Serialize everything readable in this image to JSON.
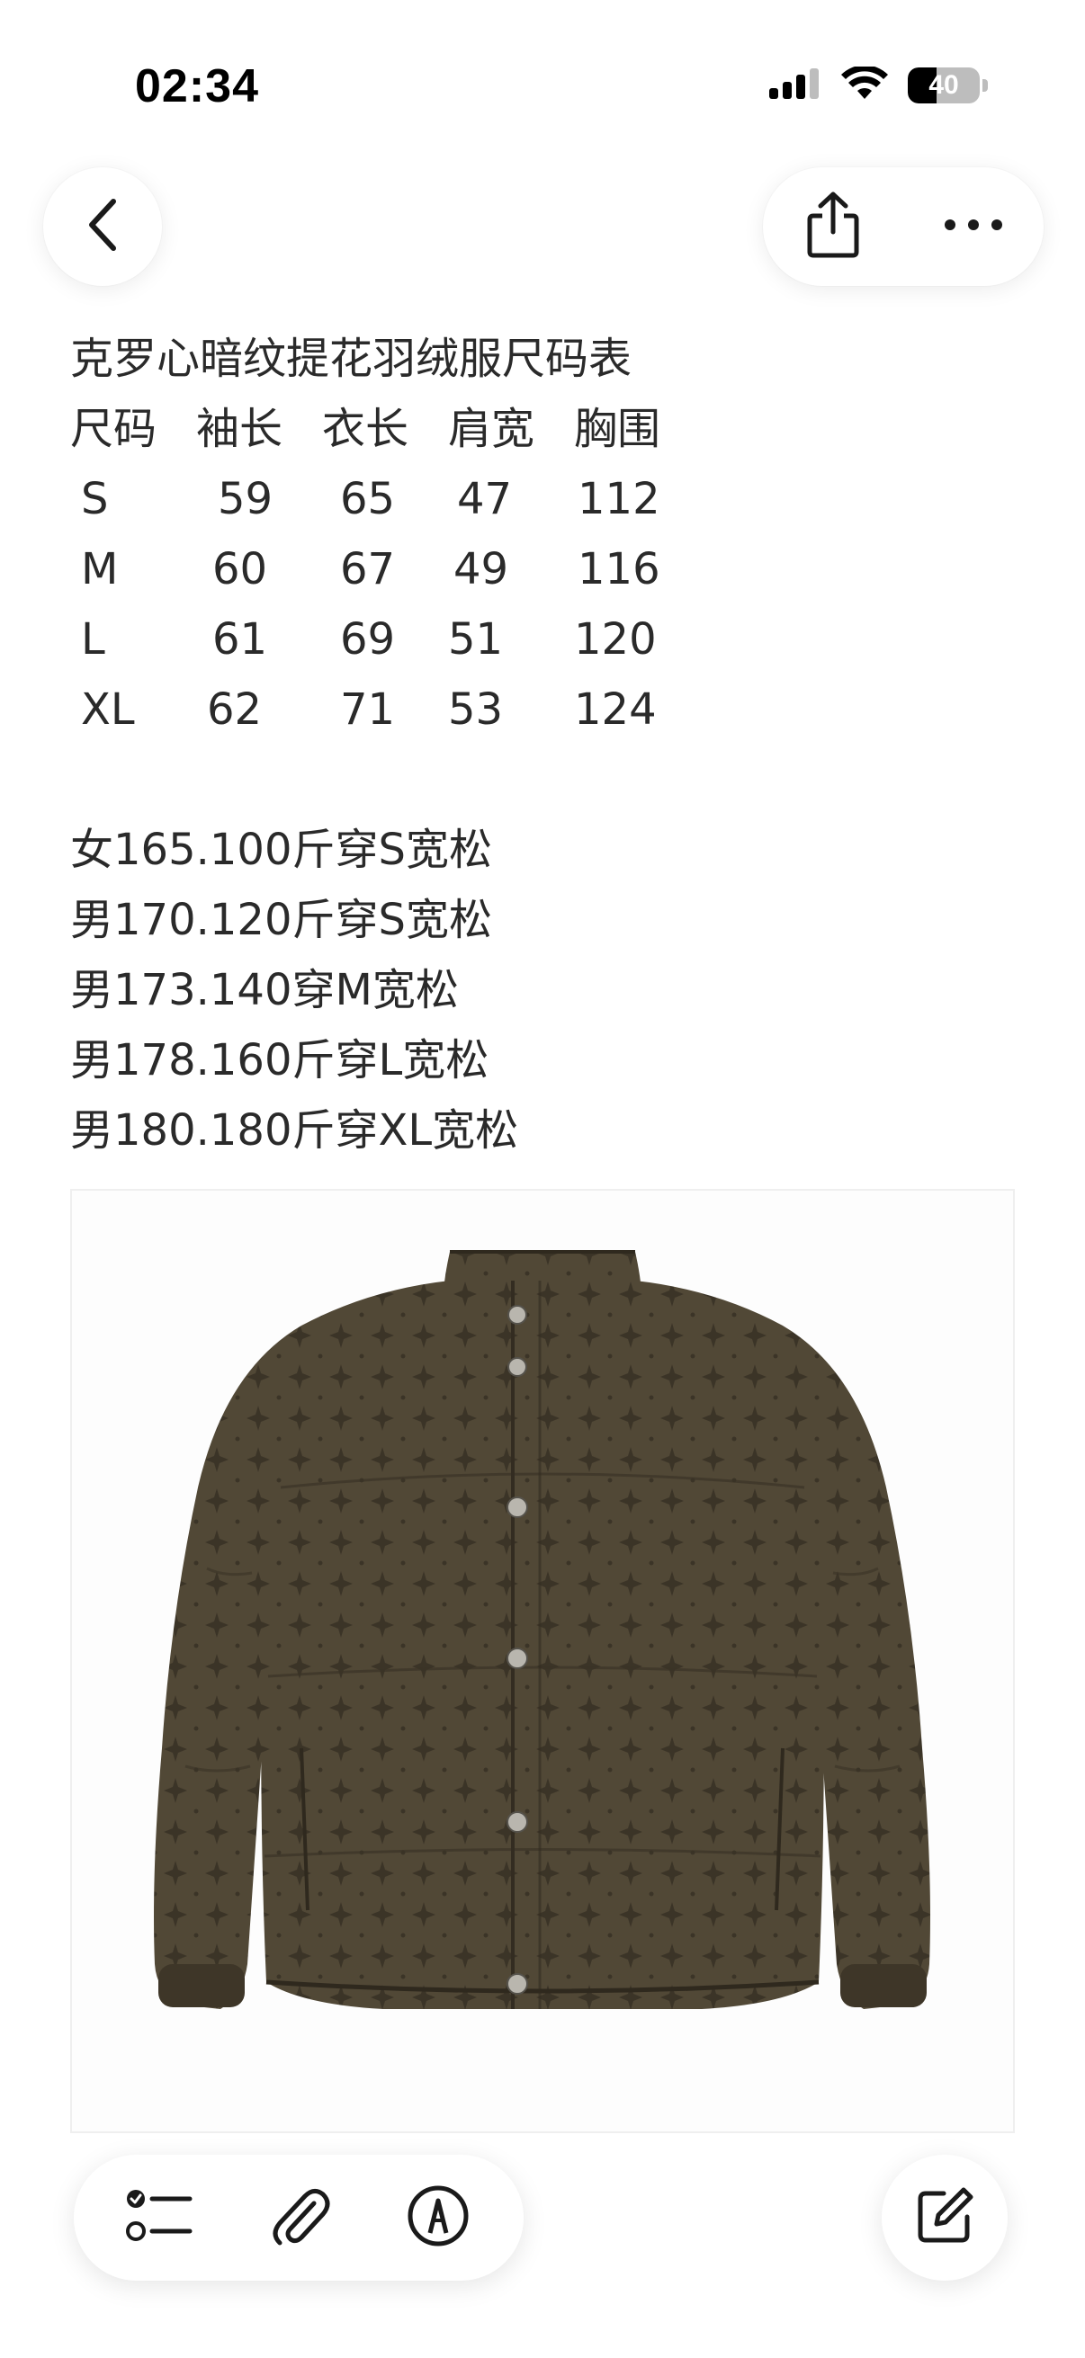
{
  "status_bar": {
    "time": "02:34",
    "battery_level": "40",
    "battery_fraction": 0.4,
    "icons": [
      "signal-icon",
      "wifi-icon",
      "battery-icon"
    ]
  },
  "nav": {
    "back_icon": "chevron-left-icon",
    "share_icon": "share-icon",
    "more_icon": "ellipsis-icon"
  },
  "note": {
    "title": "克罗心暗纹提花羽绒服尺码表",
    "size_table": {
      "headers": [
        "尺码",
        "袖长",
        "衣长",
        "肩宽",
        "胸围"
      ],
      "rows": [
        [
          "S",
          "59",
          "65",
          "47",
          "112"
        ],
        [
          "M",
          "60",
          "67",
          "49",
          "116"
        ],
        [
          "L",
          "61",
          "69",
          "51",
          "120"
        ],
        [
          "XL",
          "62",
          "71",
          "53",
          "124"
        ]
      ]
    },
    "recommendations": [
      "女165.100斤穿S宽松",
      "男170.120斤穿S宽松",
      "男173.140穿M宽松",
      "男178.160斤穿L宽松",
      "男180.180斤穿XL宽松"
    ]
  },
  "toolbar": {
    "checklist_icon": "checklist-icon",
    "attachment_icon": "paperclip-icon",
    "markup_icon": "pen-markup-icon",
    "compose_icon": "compose-icon"
  },
  "colors": {
    "jacket": "#4f4636",
    "jacket_pattern": "#3a3326",
    "text": "#2a2a2a"
  }
}
